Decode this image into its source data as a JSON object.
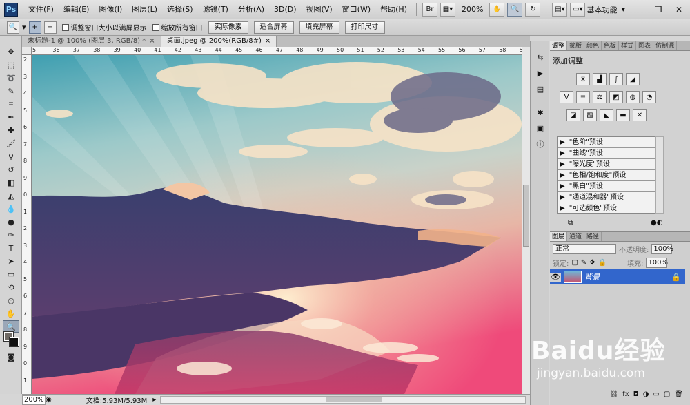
{
  "app": {
    "logo_text": "Ps",
    "menu": [
      "文件(F)",
      "编辑(E)",
      "图像(I)",
      "图层(L)",
      "选择(S)",
      "滤镜(T)",
      "分析(A)",
      "3D(D)",
      "视图(V)",
      "窗口(W)",
      "帮助(H)"
    ],
    "zoom_menu": "200%",
    "workspace": "基本功能"
  },
  "options": {
    "checkbox_resize": "调整窗口大小以满屏显示",
    "checkbox_all": "缩放所有窗口",
    "btn_actual": "实际像素",
    "btn_fit": "适合屏幕",
    "btn_fill": "填充屏幕",
    "btn_print": "打印尺寸"
  },
  "tabs": [
    {
      "label": "未标题-1 @ 100% (图层 3, RGB/8) *",
      "close": "×"
    },
    {
      "label": "桌面.jpeg @ 200%(RGB/8#)",
      "close": "×"
    }
  ],
  "ruler_top": [
    "5",
    "36",
    "37",
    "38",
    "39",
    "40",
    "41",
    "42",
    "43",
    "44",
    "45",
    "46",
    "47",
    "48",
    "49",
    "50",
    "51",
    "52",
    "53",
    "54",
    "55",
    "56",
    "57",
    "58",
    "59"
  ],
  "ruler_left": [
    "2",
    "3",
    "4",
    "5",
    "6",
    "7",
    "8",
    "9",
    "0",
    "1",
    "2",
    "3",
    "4",
    "5",
    "6",
    "7",
    "8",
    "9",
    "0",
    "1"
  ],
  "status": {
    "zoom": "200%",
    "doc": "文档:5.93M/5.93M"
  },
  "panels": {
    "top_tabs": [
      "调整",
      "蒙版",
      "颜色",
      "色板",
      "样式",
      "图表",
      "仿制源"
    ],
    "adj_title": "添加调整",
    "presets": [
      "\"色阶\"预设",
      "\"曲线\"预设",
      "\"曝光度\"预设",
      "\"色相/饱和度\"预设",
      "\"黑白\"预设",
      "\"通道混和器\"预设",
      "\"可选颜色\"预设"
    ],
    "layer_tabs": [
      "图层",
      "通道",
      "路径"
    ],
    "blend_mode": "正常",
    "opacity_label": "不透明度:",
    "opacity_value": "100%",
    "lock_label": "锁定:",
    "fill_label": "填充:",
    "fill_value": "100%",
    "layer_name": "背景"
  },
  "watermark": {
    "main": "Baidu经验",
    "sub": "jingyan.baidu.com"
  }
}
